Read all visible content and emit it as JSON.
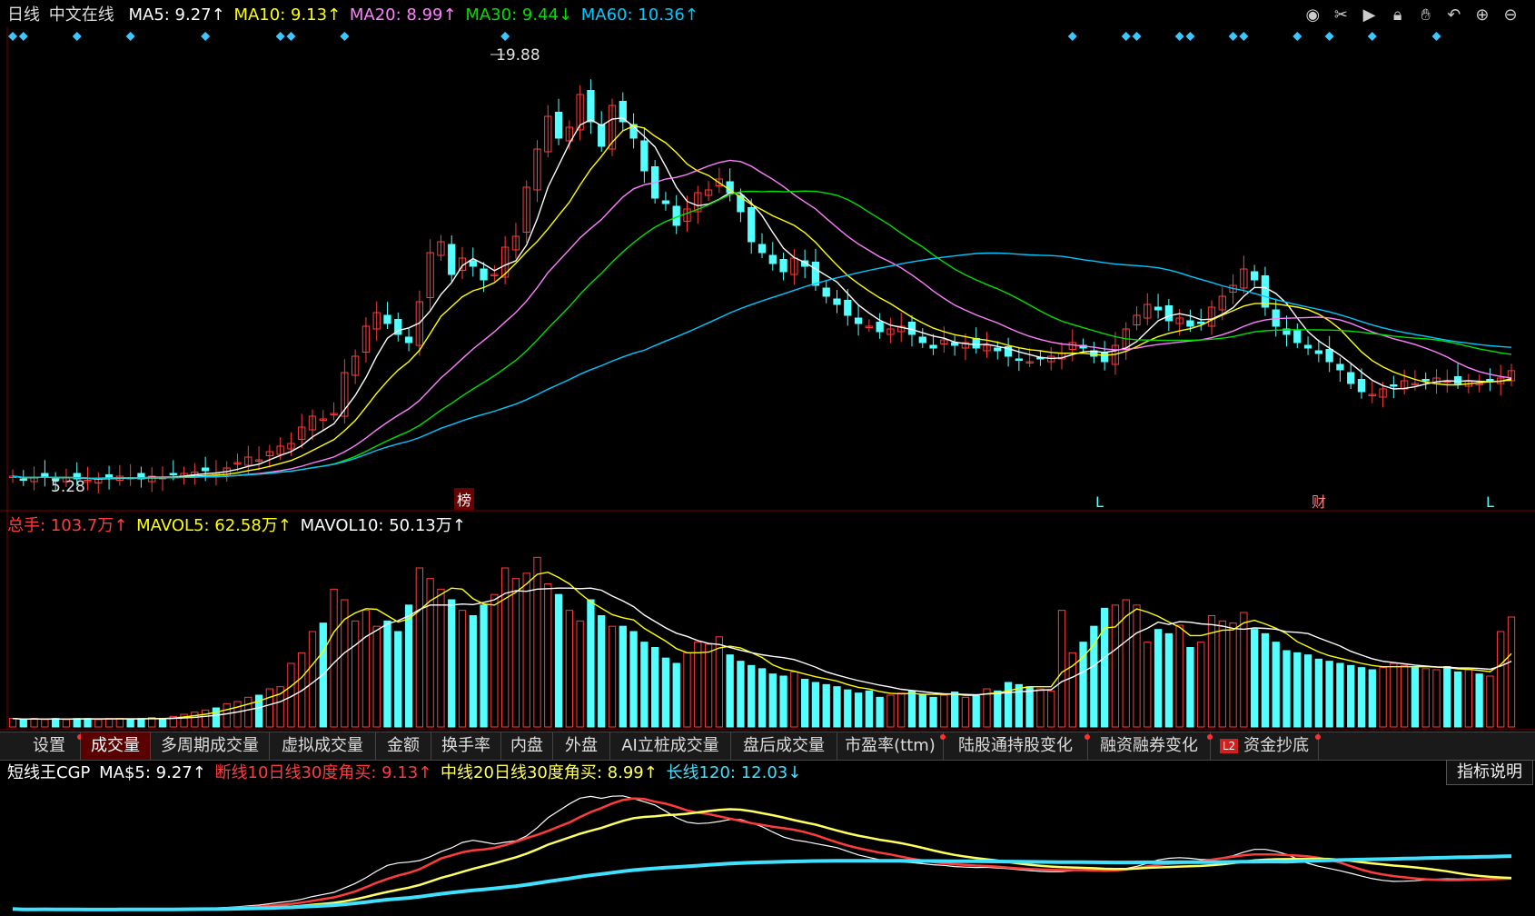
{
  "main_header": {
    "period": "日线",
    "name": "中文在线",
    "ma5": "MA5: 9.27↑",
    "ma10": "MA10: 9.13↑",
    "ma20": "MA20: 8.99↑",
    "ma30": "MA30: 9.44↓",
    "ma60": "MA60: 10.36↑"
  },
  "vol_header": {
    "total": "总手: 103.7万↑",
    "mavol5": "MAVOL5: 62.58万↑",
    "mavol10": "MAVOL10: 50.13万↑"
  },
  "cgp_header": {
    "name": "短线王CGP",
    "ma5": "MA$5: 9.27↑",
    "short": "断线10日线30度角买: 9.13↑",
    "mid": "中线20日线30度角买: 8.99↑",
    "long": "长线120: 12.03↓"
  },
  "markers": {
    "high_price": "19.88",
    "low_price": "5.28",
    "bang": "榜",
    "cai": "财",
    "l1": "L",
    "l2": "L"
  },
  "tabs": [
    "设置",
    "成交量",
    "多周期成交量",
    "虚拟成交量",
    "金额",
    "换手率",
    "内盘",
    "外盘",
    "AI立桩成交量",
    "盘后成交量",
    "市盈率(ttm)",
    "陆股通持股变化",
    "融资融券变化",
    "资金抄底"
  ],
  "l2_badge": "L2",
  "explain_button": "指标说明",
  "toolbar_icons": [
    "eye-icon",
    "scissors-icon",
    "play-icon",
    "lock-icon",
    "hand-icon",
    "undo-icon",
    "zoom-in-icon",
    "zoom-out-icon"
  ],
  "colors": {
    "up": "#ff3c3c",
    "down": "#54ffff",
    "ma5": "#ffffff",
    "ma10": "#ffff00",
    "ma20": "#ff80ff",
    "ma30": "#00e000",
    "ma60": "#00c8ff"
  },
  "chart_data": [
    {
      "type": "candlestick",
      "title": "中文在线 日线",
      "ylim": [
        5.0,
        21.0
      ],
      "close": [
        5.4,
        5.3,
        5.35,
        5.4,
        5.3,
        5.35,
        5.3,
        5.25,
        5.3,
        5.35,
        5.4,
        5.35,
        5.3,
        5.4,
        5.35,
        5.45,
        5.5,
        5.55,
        5.6,
        5.5,
        5.7,
        5.9,
        6.1,
        6.0,
        6.3,
        6.5,
        6.6,
        7.2,
        7.6,
        7.5,
        7.7,
        9.2,
        9.8,
        10.9,
        11.4,
        11.0,
        10.6,
        10.3,
        11.8,
        13.6,
        14.0,
        12.8,
        13.4,
        13.1,
        12.6,
        12.8,
        13.8,
        14.2,
        16.0,
        17.4,
        18.6,
        17.8,
        18.2,
        19.4,
        18.4,
        17.5,
        19.0,
        18.4,
        17.8,
        16.6,
        15.6,
        15.4,
        14.6,
        15.2,
        15.8,
        15.9,
        16.3,
        15.8,
        15.1,
        14.0,
        13.6,
        13.2,
        12.9,
        13.4,
        13.1,
        12.4,
        12.0,
        11.7,
        11.3,
        11.0,
        10.9,
        10.7,
        10.8,
        10.9,
        10.6,
        10.3,
        10.1,
        10.4,
        10.2,
        10.3,
        10.1,
        10.2,
        10.0,
        9.8,
        9.7,
        9.6,
        9.7,
        9.8,
        9.9,
        10.3,
        10.1,
        9.8,
        9.6,
        10.2,
        10.8,
        11.3,
        11.7,
        11.5,
        11.1,
        11.2,
        10.9,
        11.0,
        11.6,
        12.0,
        12.4,
        13.0,
        12.6,
        11.6,
        10.9,
        10.6,
        10.3,
        10.1,
        9.9,
        9.6,
        9.3,
        8.8,
        8.5,
        8.4,
        8.6,
        8.7,
        8.9,
        8.8,
        8.9,
        9.0,
        8.9,
        8.8,
        8.9,
        8.8,
        8.9,
        9.0,
        9.27
      ],
      "markers": {
        "high": 19.88,
        "low": 5.28
      }
    },
    {
      "type": "bar",
      "title": "成交量",
      "unit": "万",
      "ylim": [
        0,
        180
      ],
      "values": [
        8,
        7,
        8,
        7,
        8,
        7,
        8,
        8,
        7,
        8,
        8,
        7,
        8,
        9,
        8,
        10,
        12,
        14,
        16,
        18,
        22,
        24,
        28,
        30,
        36,
        38,
        60,
        70,
        90,
        98,
        130,
        120,
        100,
        110,
        95,
        100,
        90,
        115,
        150,
        140,
        130,
        120,
        110,
        105,
        115,
        125,
        150,
        140,
        145,
        160,
        135,
        125,
        110,
        100,
        120,
        105,
        95,
        95,
        90,
        80,
        75,
        65,
        60,
        70,
        80,
        78,
        85,
        68,
        62,
        58,
        55,
        50,
        48,
        52,
        45,
        42,
        40,
        38,
        35,
        32,
        34,
        28,
        30,
        32,
        34,
        30,
        28,
        30,
        33,
        28,
        30,
        36,
        34,
        42,
        40,
        38,
        36,
        34,
        110,
        70,
        80,
        95,
        112,
        115,
        120,
        115,
        80,
        92,
        88,
        96,
        75,
        80,
        105,
        100,
        98,
        108,
        92,
        88,
        80,
        72,
        70,
        68,
        64,
        62,
        60,
        58,
        56,
        54,
        56,
        60,
        58,
        56,
        55,
        54,
        57,
        52,
        54,
        50,
        48,
        90,
        103.7
      ],
      "series": [
        {
          "name": "MAVOL5",
          "value": 62.58
        },
        {
          "name": "MAVOL10",
          "value": 50.13
        }
      ]
    },
    {
      "type": "line",
      "title": "短线王CGP",
      "series": [
        {
          "name": "MA$5",
          "last": 9.27
        },
        {
          "name": "断线10日线30度角买",
          "last": 9.13
        },
        {
          "name": "中线20日线30度角买",
          "last": 8.99
        },
        {
          "name": "长线120",
          "last": 12.03
        }
      ]
    }
  ]
}
